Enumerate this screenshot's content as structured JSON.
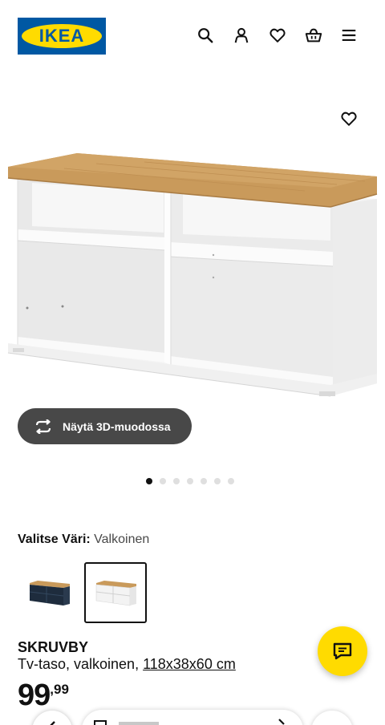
{
  "header": {
    "logo_text": "IKEA",
    "icons": [
      "search-icon",
      "user-icon",
      "heart-icon",
      "basket-icon",
      "menu-icon"
    ]
  },
  "product_image": {
    "favorite_icon": "heart-icon",
    "view_3d_label": "Näytä 3D-muodossa",
    "carousel": {
      "total": 7,
      "active": 0
    }
  },
  "color": {
    "label": "Valitse Väri:",
    "value": "Valkoinen",
    "swatches": [
      {
        "name": "dark-blue",
        "selected": false
      },
      {
        "name": "white",
        "selected": true
      }
    ]
  },
  "product": {
    "name": "SKRUVBY",
    "description": "Tv-taso, valkoinen,",
    "measurements": "118x38x60 cm",
    "price_int": "99",
    "price_dec": ",99"
  },
  "colors": {
    "ikea_blue": "#0058a3",
    "ikea_yellow": "#ffdb00",
    "wood": "#c99a5b",
    "dark_button": "#484848"
  }
}
